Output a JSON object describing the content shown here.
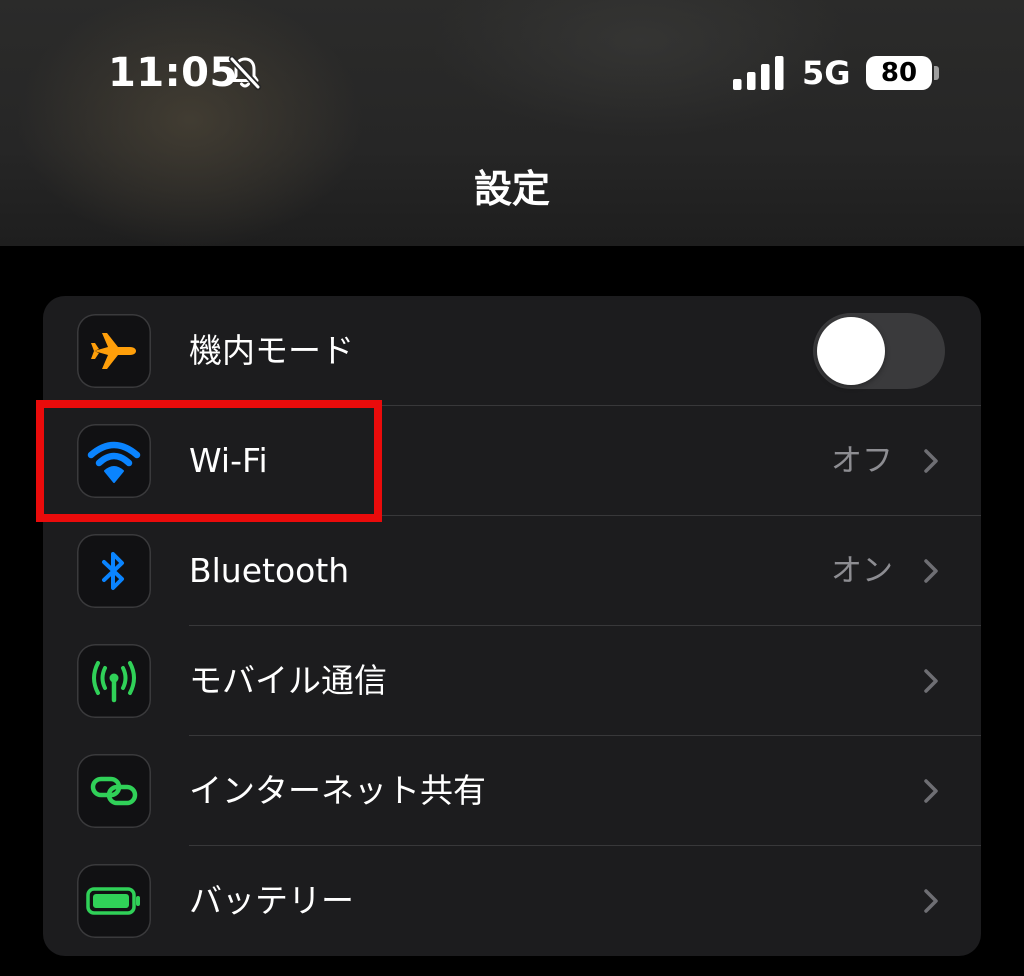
{
  "status_bar": {
    "time": "11:05",
    "network": "5G",
    "battery": "80"
  },
  "header": {
    "title": "設定"
  },
  "settings": {
    "rows": [
      {
        "label": "機内モード",
        "icon": "airplane-icon",
        "control": "toggle",
        "toggle_on": false
      },
      {
        "label": "Wi-Fi",
        "icon": "wifi-icon",
        "value": "オフ"
      },
      {
        "label": "Bluetooth",
        "icon": "bluetooth-icon",
        "value": "オン"
      },
      {
        "label": "モバイル通信",
        "icon": "antenna-icon"
      },
      {
        "label": "インターネット共有",
        "icon": "link-icon"
      },
      {
        "label": "バッテリー",
        "icon": "battery-icon"
      }
    ]
  },
  "colors": {
    "airplane": "#ff9f0a",
    "wifi_bluetooth": "#0a84ff",
    "green": "#30d158",
    "highlight": "#ea0b0b",
    "group_background": "#1c1c1e"
  }
}
